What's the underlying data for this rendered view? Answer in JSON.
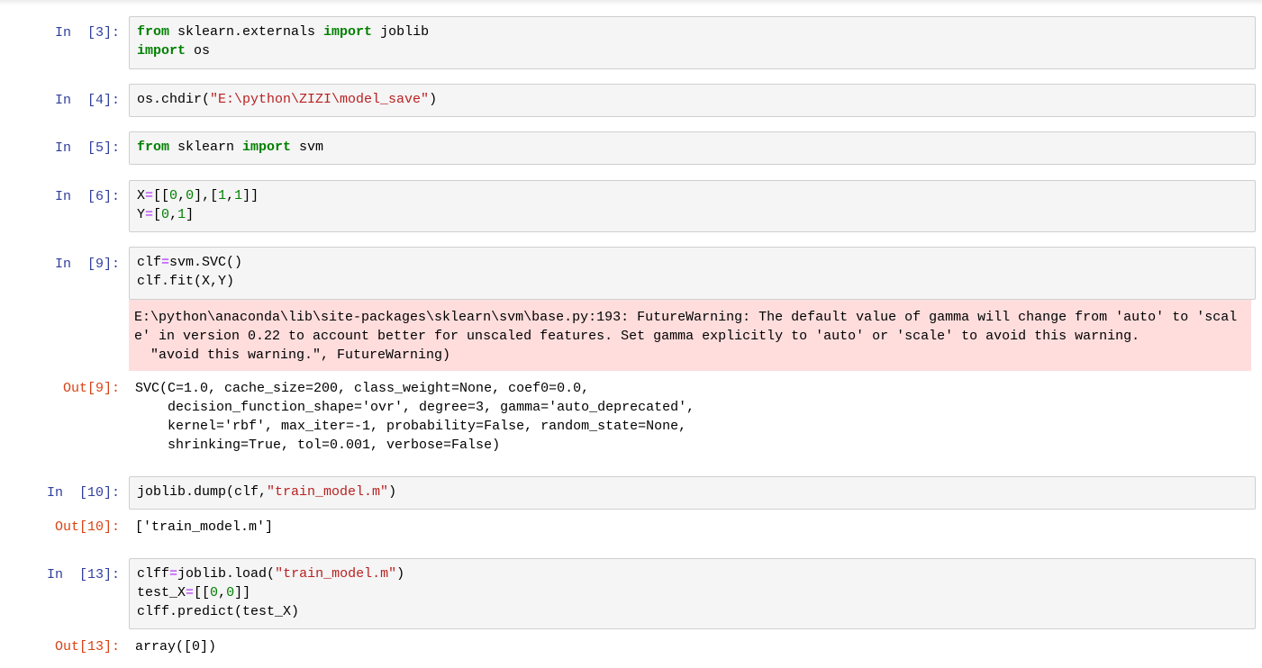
{
  "notebook": {
    "cells": [
      {
        "in_prompt": "In  [3]:",
        "code": [
          [
            {
              "t": "from",
              "c": "kw"
            },
            {
              "t": " sklearn.externals "
            },
            {
              "t": "import",
              "c": "kw"
            },
            {
              "t": " joblib"
            }
          ],
          [
            {
              "t": "import",
              "c": "kw"
            },
            {
              "t": " os"
            }
          ]
        ]
      },
      {
        "in_prompt": "In  [4]:",
        "code": [
          [
            {
              "t": "os.chdir("
            },
            {
              "t": "\"E:\\python\\ZIZI\\model_save\"",
              "c": "str"
            },
            {
              "t": ")"
            }
          ]
        ]
      },
      {
        "in_prompt": "In  [5]:",
        "code": [
          [
            {
              "t": "from",
              "c": "kw"
            },
            {
              "t": " sklearn "
            },
            {
              "t": "import",
              "c": "kw"
            },
            {
              "t": " svm"
            }
          ]
        ]
      },
      {
        "in_prompt": "In  [6]:",
        "code": [
          [
            {
              "t": "X"
            },
            {
              "t": "=",
              "c": "op"
            },
            {
              "t": "[["
            },
            {
              "t": "0",
              "c": "num"
            },
            {
              "t": ","
            },
            {
              "t": "0",
              "c": "num"
            },
            {
              "t": "],["
            },
            {
              "t": "1",
              "c": "num"
            },
            {
              "t": ","
            },
            {
              "t": "1",
              "c": "num"
            },
            {
              "t": "]]"
            }
          ],
          [
            {
              "t": "Y"
            },
            {
              "t": "=",
              "c": "op"
            },
            {
              "t": "["
            },
            {
              "t": "0",
              "c": "num"
            },
            {
              "t": ","
            },
            {
              "t": "1",
              "c": "num"
            },
            {
              "t": "]"
            }
          ]
        ]
      },
      {
        "in_prompt": "In  [9]:",
        "code": [
          [
            {
              "t": "clf"
            },
            {
              "t": "=",
              "c": "op"
            },
            {
              "t": "svm.SVC()"
            }
          ],
          [
            {
              "t": "clf.fit(X,Y)"
            }
          ]
        ],
        "stderr": [
          "E:\\python\\anaconda\\lib\\site-packages\\sklearn\\svm\\base.py:193: FutureWarning: The default value of gamma will change from 'auto' to 'scal",
          "e' in version 0.22 to account better for unscaled features. Set gamma explicitly to 'auto' or 'scale' to avoid this warning.",
          "  \"avoid this warning.\", FutureWarning)"
        ],
        "out_prompt": "Out[9]:",
        "output": [
          "SVC(C=1.0, cache_size=200, class_weight=None, coef0=0.0,",
          "    decision_function_shape='ovr', degree=3, gamma='auto_deprecated',",
          "    kernel='rbf', max_iter=-1, probability=False, random_state=None,",
          "    shrinking=True, tol=0.001, verbose=False)"
        ]
      },
      {
        "in_prompt": "In  [10]:",
        "code": [
          [
            {
              "t": "joblib.dump(clf,"
            },
            {
              "t": "\"train_model.m\"",
              "c": "str"
            },
            {
              "t": ")"
            }
          ]
        ],
        "out_prompt": "Out[10]:",
        "output": [
          "['train_model.m']"
        ]
      },
      {
        "in_prompt": "In  [13]:",
        "code": [
          [
            {
              "t": "clff"
            },
            {
              "t": "=",
              "c": "op"
            },
            {
              "t": "joblib.load("
            },
            {
              "t": "\"train_model.m\"",
              "c": "str"
            },
            {
              "t": ")"
            }
          ],
          [
            {
              "t": "test_X"
            },
            {
              "t": "=",
              "c": "op"
            },
            {
              "t": "[["
            },
            {
              "t": "0",
              "c": "num"
            },
            {
              "t": ","
            },
            {
              "t": "0",
              "c": "num"
            },
            {
              "t": "]]"
            }
          ],
          [
            {
              "t": "clff.predict(test_X)"
            }
          ]
        ],
        "out_prompt": "Out[13]:",
        "output": [
          "array([0])"
        ]
      }
    ]
  }
}
